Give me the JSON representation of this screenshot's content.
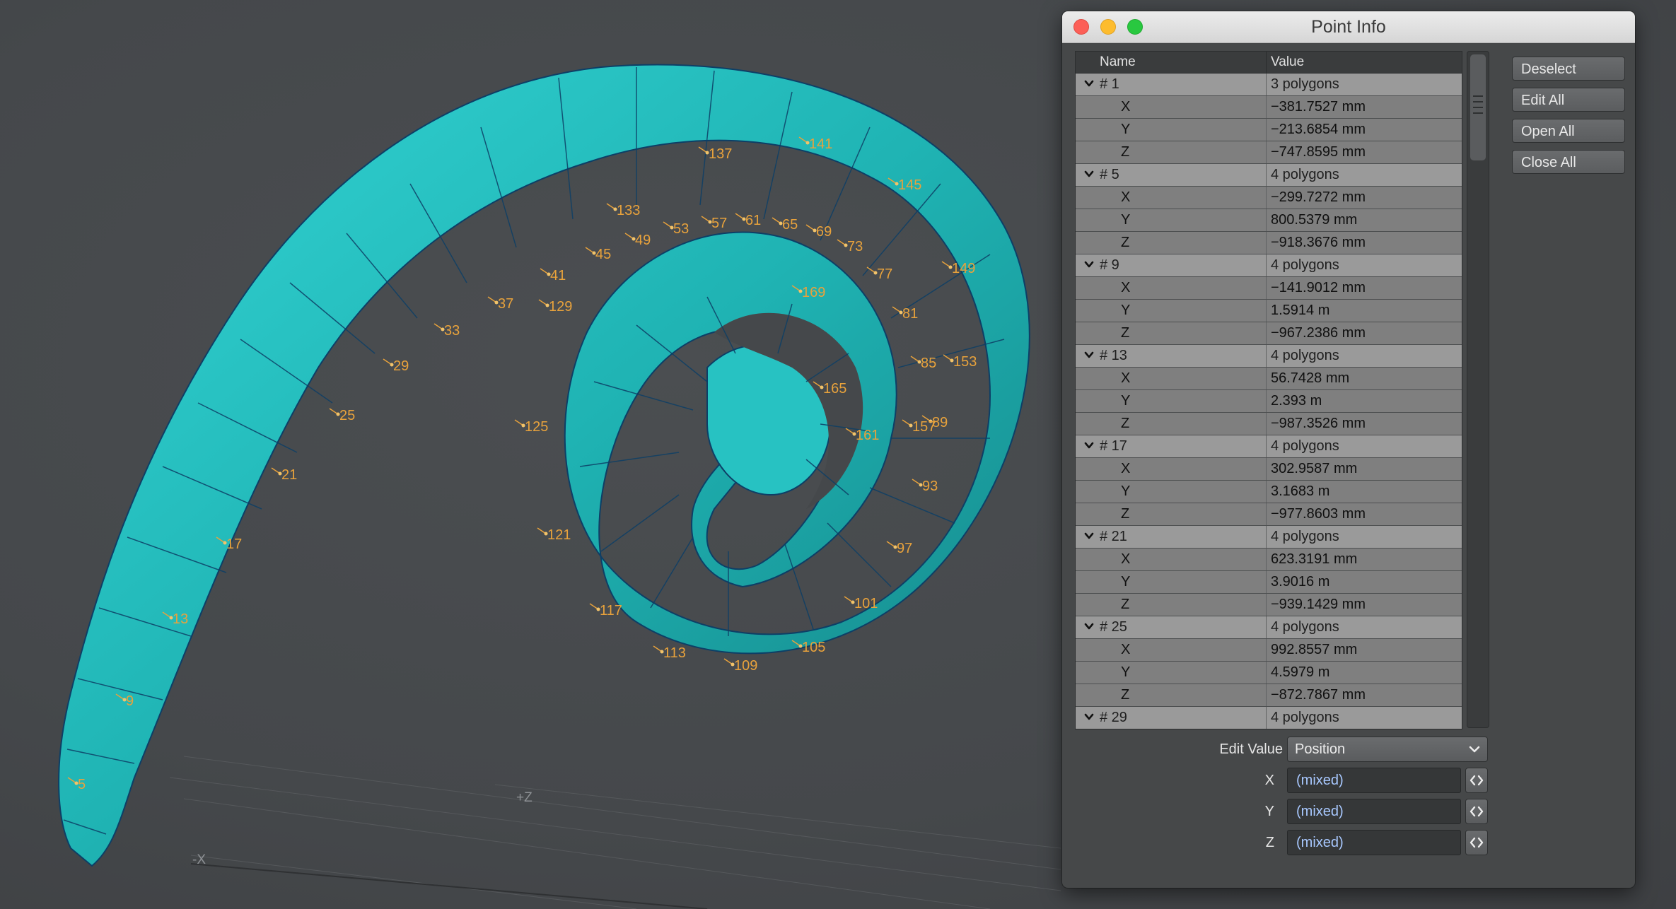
{
  "viewport": {
    "vertex_labels": [
      {
        "id": "5",
        "label": "5"
      },
      {
        "id": "9",
        "label": "9"
      },
      {
        "id": "13",
        "label": "13"
      },
      {
        "id": "17",
        "label": "17"
      },
      {
        "id": "21",
        "label": "21"
      },
      {
        "id": "25",
        "label": "25"
      },
      {
        "id": "29",
        "label": "29"
      },
      {
        "id": "33",
        "label": "33"
      },
      {
        "id": "37",
        "label": "37"
      },
      {
        "id": "41",
        "label": "41"
      },
      {
        "id": "45",
        "label": "45"
      },
      {
        "id": "49",
        "label": "49"
      },
      {
        "id": "53",
        "label": "53"
      },
      {
        "id": "57",
        "label": "57"
      },
      {
        "id": "61",
        "label": "61"
      },
      {
        "id": "65",
        "label": "65"
      },
      {
        "id": "69",
        "label": "69"
      },
      {
        "id": "73",
        "label": "73"
      },
      {
        "id": "77",
        "label": "77"
      },
      {
        "id": "81",
        "label": "81"
      },
      {
        "id": "85",
        "label": "85"
      },
      {
        "id": "89",
        "label": "89"
      },
      {
        "id": "93",
        "label": "93"
      },
      {
        "id": "97",
        "label": "97"
      },
      {
        "id": "101",
        "label": "101"
      },
      {
        "id": "105",
        "label": "105"
      },
      {
        "id": "109",
        "label": "109"
      },
      {
        "id": "113",
        "label": "113"
      },
      {
        "id": "117",
        "label": "117"
      },
      {
        "id": "121",
        "label": "121"
      },
      {
        "id": "125",
        "label": "125"
      },
      {
        "id": "129",
        "label": "129"
      },
      {
        "id": "133",
        "label": "133"
      },
      {
        "id": "137",
        "label": "137"
      },
      {
        "id": "141",
        "label": "141"
      },
      {
        "id": "145",
        "label": "145"
      },
      {
        "id": "149",
        "label": "149"
      },
      {
        "id": "153",
        "label": "153"
      },
      {
        "id": "157",
        "label": "157"
      },
      {
        "id": "161",
        "label": "161"
      },
      {
        "id": "165",
        "label": "165"
      },
      {
        "id": "169",
        "label": "169"
      }
    ],
    "axis_labels": {
      "plus_z": "+Z",
      "minus_x": "-X"
    },
    "colors": {
      "mesh": "#1fb3b3",
      "vertex_label": "#e8a23c",
      "wire": "#0d3f66"
    }
  },
  "window": {
    "title": "Point Info",
    "table": {
      "headers": {
        "name": "Name",
        "value": "Value"
      },
      "groups": [
        {
          "name": "# 1",
          "value": "3 polygons",
          "rows": [
            {
              "axis": "X",
              "value": "−381.7527 mm"
            },
            {
              "axis": "Y",
              "value": "−213.6854 mm"
            },
            {
              "axis": "Z",
              "value": "−747.8595 mm"
            }
          ]
        },
        {
          "name": "# 5",
          "value": "4 polygons",
          "rows": [
            {
              "axis": "X",
              "value": "−299.7272 mm"
            },
            {
              "axis": "Y",
              "value": "800.5379 mm"
            },
            {
              "axis": "Z",
              "value": "−918.3676 mm"
            }
          ]
        },
        {
          "name": "# 9",
          "value": "4 polygons",
          "rows": [
            {
              "axis": "X",
              "value": "−141.9012 mm"
            },
            {
              "axis": "Y",
              "value": "1.5914 m"
            },
            {
              "axis": "Z",
              "value": "−967.2386 mm"
            }
          ]
        },
        {
          "name": "# 13",
          "value": "4 polygons",
          "rows": [
            {
              "axis": "X",
              "value": "56.7428 mm"
            },
            {
              "axis": "Y",
              "value": "2.393 m"
            },
            {
              "axis": "Z",
              "value": "−987.3526 mm"
            }
          ]
        },
        {
          "name": "# 17",
          "value": "4 polygons",
          "rows": [
            {
              "axis": "X",
              "value": "302.9587 mm"
            },
            {
              "axis": "Y",
              "value": "3.1683 m"
            },
            {
              "axis": "Z",
              "value": "−977.8603 mm"
            }
          ]
        },
        {
          "name": "# 21",
          "value": "4 polygons",
          "rows": [
            {
              "axis": "X",
              "value": "623.3191 mm"
            },
            {
              "axis": "Y",
              "value": "3.9016 m"
            },
            {
              "axis": "Z",
              "value": "−939.1429 mm"
            }
          ]
        },
        {
          "name": "# 25",
          "value": "4 polygons",
          "rows": [
            {
              "axis": "X",
              "value": "992.8557 mm"
            },
            {
              "axis": "Y",
              "value": "4.5979 m"
            },
            {
              "axis": "Z",
              "value": "−872.7867 mm"
            }
          ]
        },
        {
          "name": "# 29",
          "value": "4 polygons",
          "rows": []
        }
      ]
    },
    "buttons": {
      "deselect": "Deselect",
      "edit_all": "Edit All",
      "open_all": "Open All",
      "close_all": "Close All"
    },
    "edit": {
      "label": "Edit Value",
      "selected": "Position",
      "fields": [
        {
          "axis": "X",
          "value": "(mixed)"
        },
        {
          "axis": "Y",
          "value": "(mixed)"
        },
        {
          "axis": "Z",
          "value": "(mixed)"
        }
      ]
    },
    "icons": {
      "close": "close-icon",
      "minimize": "minimize-icon",
      "zoom": "zoom-icon",
      "disclosure": "chevron-down-icon",
      "stepper": "stepper-icon"
    }
  }
}
